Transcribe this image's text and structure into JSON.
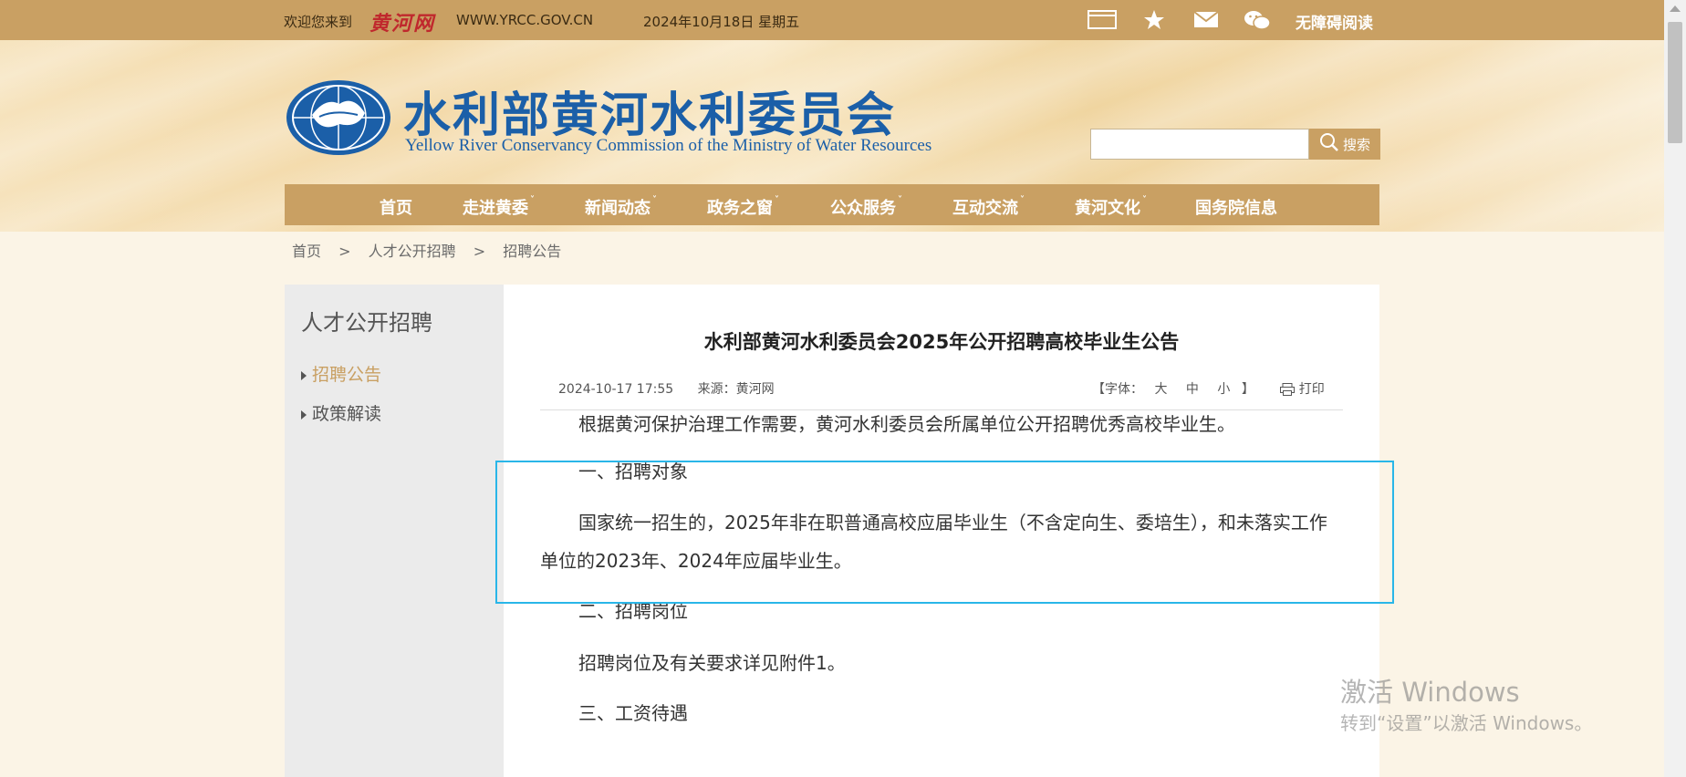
{
  "topbar": {
    "welcome": "欢迎您来到",
    "site_logo_text": "黄河网",
    "url": "WWW.YRCC.GOV.CN",
    "date": "2024年10月18日 星期五",
    "icons": [
      "screen-icon",
      "star-icon",
      "mail-icon",
      "wechat-icon"
    ],
    "accessibility": "无障碍阅读"
  },
  "header": {
    "title_cn": "水利部黄河水利委员会",
    "title_en": "Yellow River Conservancy Commission of the Ministry of Water Resources",
    "search_button": "搜索",
    "search_placeholder": ""
  },
  "nav": {
    "items": [
      {
        "label": "首页",
        "has_caret": false
      },
      {
        "label": "走进黄委",
        "has_caret": true
      },
      {
        "label": "新闻动态",
        "has_caret": true
      },
      {
        "label": "政务之窗",
        "has_caret": true
      },
      {
        "label": "公众服务",
        "has_caret": true
      },
      {
        "label": "互动交流",
        "has_caret": true
      },
      {
        "label": "黄河文化",
        "has_caret": true
      },
      {
        "label": "国务院信息",
        "has_caret": false
      }
    ],
    "caret": "˅"
  },
  "breadcrumb": {
    "items": [
      "首页",
      "人才公开招聘",
      "招聘公告"
    ],
    "separator": ">"
  },
  "sidebar": {
    "heading": "人才公开招聘",
    "links": [
      {
        "label": "招聘公告",
        "active": true
      },
      {
        "label": "政策解读",
        "active": false
      }
    ]
  },
  "article": {
    "title": "水利部黄河水利委员会2025年公开招聘高校毕业生公告",
    "datetime": "2024-10-17 17:55",
    "source_label": "来源：",
    "source": "黄河网",
    "font_label": "【字体：",
    "font_sizes": [
      "大",
      "中",
      "小"
    ],
    "font_close": "】",
    "print": "打印",
    "paragraphs": [
      "根据黄河保护治理工作需要，黄河水利委员会所属单位公开招聘优秀高校毕业生。",
      "一、招聘对象",
      "国家统一招生的，2025年非在职普通高校应届毕业生（不含定向生、委培生），和未落实工作单位的2023年、2024年应届毕业生。",
      "二、招聘岗位",
      "招聘岗位及有关要求详见附件1。",
      "三、工资待遇"
    ]
  },
  "watermark": {
    "line1": "激活 Windows",
    "line2": "转到“设置”以激活 Windows。"
  },
  "colors": {
    "topbar": "#c9a063",
    "nav": "#c9a063",
    "brand_blue": "#1b5fa8",
    "highlight": "#29b6e8",
    "active_link": "#c9a063"
  }
}
